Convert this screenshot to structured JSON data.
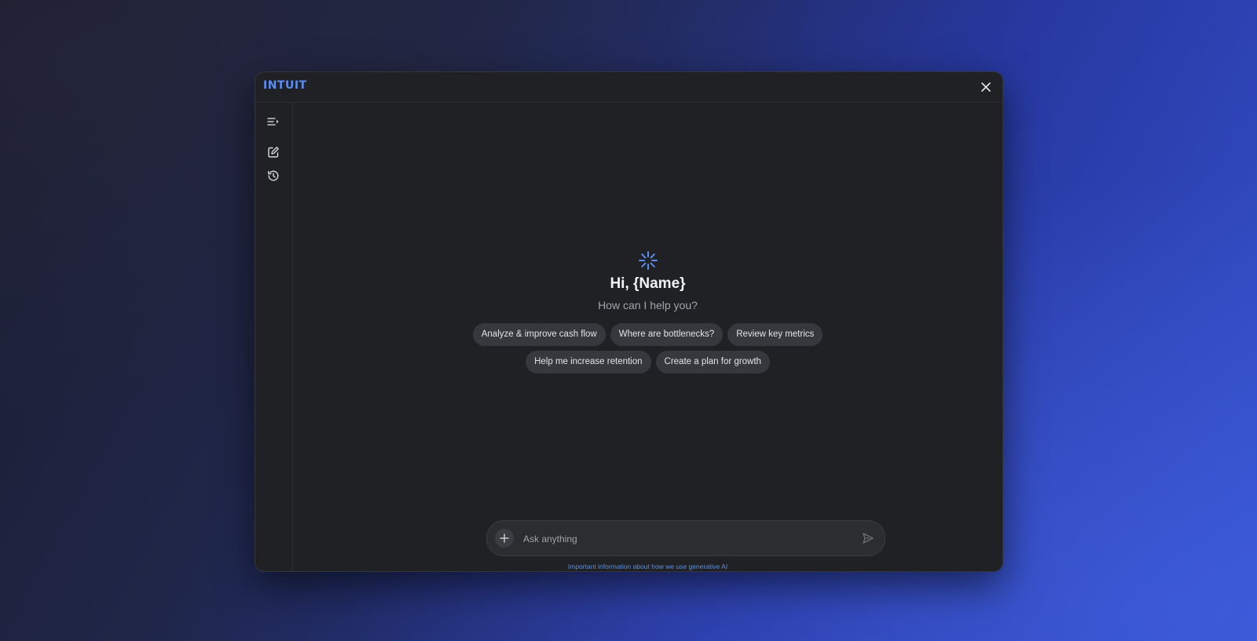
{
  "app": {
    "logo_text": "INTUIT",
    "brand_color": "#5c8ef0"
  },
  "titlebar": {
    "close_icon": "close-icon"
  },
  "sidebar": {
    "items": [
      {
        "name": "collapse-menu",
        "icon": "menu-collapse-icon"
      },
      {
        "name": "new-chat",
        "icon": "edit-icon"
      },
      {
        "name": "history",
        "icon": "history-icon"
      }
    ]
  },
  "hero": {
    "icon": "sparkle-icon",
    "greeting": "Hi, {Name}",
    "subtitle": "How can I help you?"
  },
  "suggestions": {
    "row1": [
      "Analyze & improve cash flow",
      "Where are bottlenecks?",
      "Review key metrics"
    ],
    "row2": [
      "Help me increase retention",
      "Create a plan for growth"
    ]
  },
  "composer": {
    "placeholder": "Ask anything",
    "value": "",
    "attach_icon": "plus-icon",
    "send_icon": "send-icon"
  },
  "footer": {
    "disclaimer": "Important information about how we use generative AI"
  }
}
